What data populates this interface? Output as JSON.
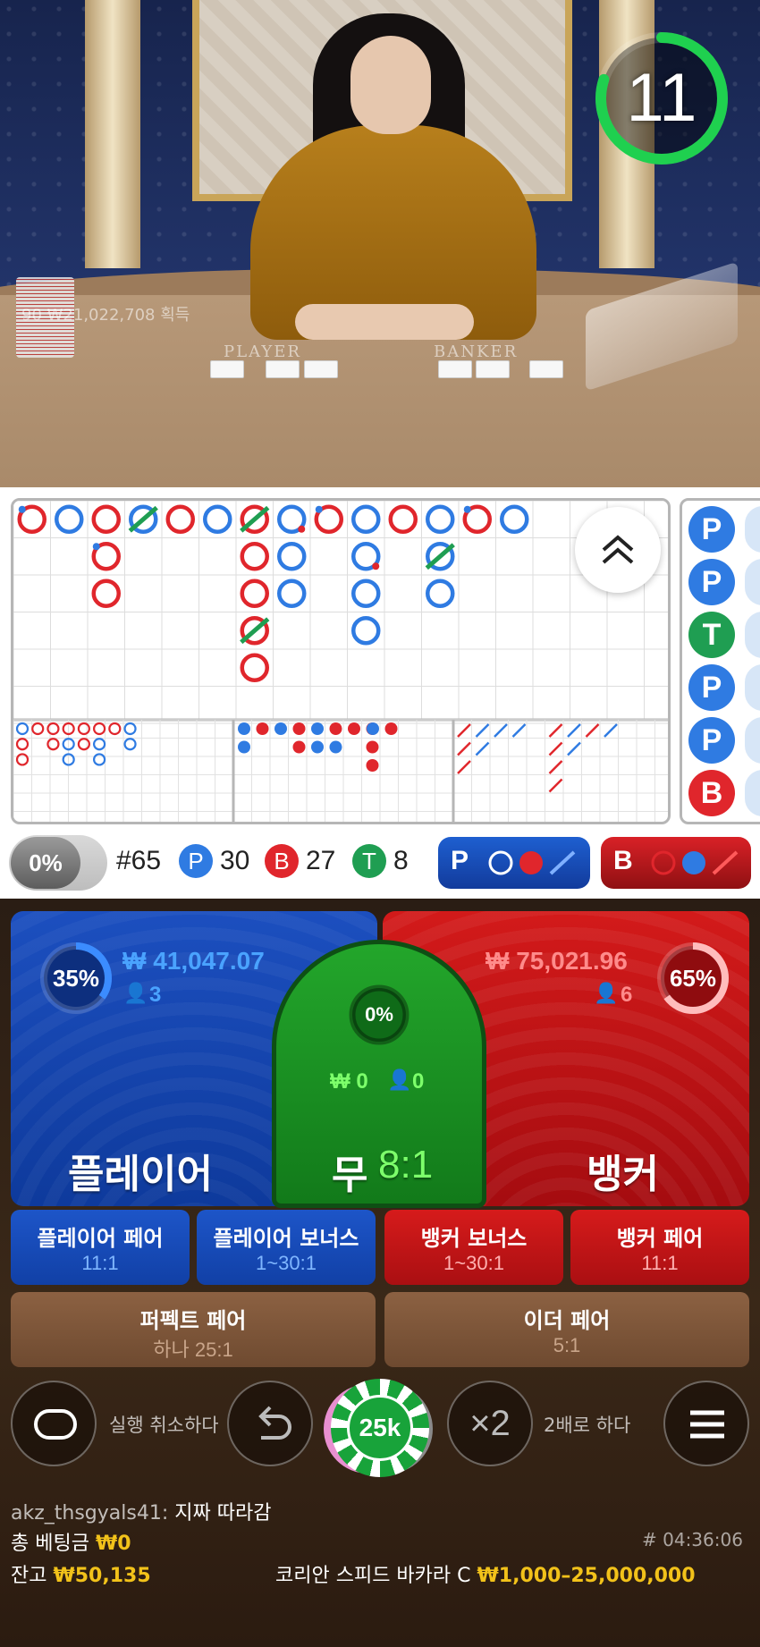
{
  "timer": {
    "seconds": "11",
    "fraction_remaining": 0.8
  },
  "video": {
    "winnings_text": "90 ₩21,022,708 획득",
    "player_label": "PLAYER",
    "banker_label": "BANKER"
  },
  "roadmap": {
    "counts": {
      "game_number": "#65",
      "player_letter": "P",
      "player": "30",
      "banker_letter": "B",
      "banker": "27",
      "tie_letter": "T",
      "tie": "8"
    },
    "percent_toggle": "0%",
    "predict_player_letter": "P",
    "predict_banker_letter": "B",
    "side_road": [
      "P",
      "P",
      "T",
      "P",
      "P",
      "B"
    ],
    "big_road": [
      {
        "col": 0,
        "row": 0,
        "c": "B",
        "tie": false,
        "dot": "blue"
      },
      {
        "col": 1,
        "row": 0,
        "c": "P",
        "tie": false,
        "dot": ""
      },
      {
        "col": 2,
        "row": 0,
        "c": "B",
        "tie": false,
        "dot": ""
      },
      {
        "col": 2,
        "row": 1,
        "c": "B",
        "tie": false,
        "dot": "blue"
      },
      {
        "col": 2,
        "row": 2,
        "c": "B",
        "tie": false,
        "dot": ""
      },
      {
        "col": 3,
        "row": 0,
        "c": "P",
        "tie": true,
        "dot": ""
      },
      {
        "col": 4,
        "row": 0,
        "c": "B",
        "tie": false,
        "dot": ""
      },
      {
        "col": 5,
        "row": 0,
        "c": "P",
        "tie": false,
        "dot": ""
      },
      {
        "col": 6,
        "row": 0,
        "c": "B",
        "tie": true,
        "dot": ""
      },
      {
        "col": 6,
        "row": 1,
        "c": "B",
        "tie": false,
        "dot": ""
      },
      {
        "col": 6,
        "row": 2,
        "c": "B",
        "tie": false,
        "dot": ""
      },
      {
        "col": 6,
        "row": 3,
        "c": "B",
        "tie": true,
        "dot": ""
      },
      {
        "col": 6,
        "row": 4,
        "c": "B",
        "tie": false,
        "dot": ""
      },
      {
        "col": 7,
        "row": 0,
        "c": "P",
        "tie": false,
        "dot": "red"
      },
      {
        "col": 7,
        "row": 1,
        "c": "P",
        "tie": false,
        "dot": ""
      },
      {
        "col": 7,
        "row": 2,
        "c": "P",
        "tie": false,
        "dot": ""
      },
      {
        "col": 8,
        "row": 0,
        "c": "B",
        "tie": false,
        "dot": "blue"
      },
      {
        "col": 9,
        "row": 0,
        "c": "P",
        "tie": false,
        "dot": ""
      },
      {
        "col": 9,
        "row": 1,
        "c": "P",
        "tie": false,
        "dot": "red"
      },
      {
        "col": 9,
        "row": 2,
        "c": "P",
        "tie": false,
        "dot": ""
      },
      {
        "col": 9,
        "row": 3,
        "c": "P",
        "tie": false,
        "dot": ""
      },
      {
        "col": 10,
        "row": 0,
        "c": "B",
        "tie": false,
        "dot": ""
      },
      {
        "col": 11,
        "row": 0,
        "c": "P",
        "tie": false,
        "dot": ""
      },
      {
        "col": 11,
        "row": 1,
        "c": "P",
        "tie": true,
        "dot": ""
      },
      {
        "col": 11,
        "row": 2,
        "c": "P",
        "tie": false,
        "dot": ""
      },
      {
        "col": 12,
        "row": 0,
        "c": "B",
        "tie": false,
        "dot": "blue"
      },
      {
        "col": 13,
        "row": 0,
        "c": "P",
        "tie": false,
        "dot": ""
      }
    ],
    "big_eye": [
      [
        "P",
        "B",
        "B",
        "B",
        "B",
        "B",
        "B",
        "P"
      ],
      [
        "B",
        "",
        "B",
        "P",
        "B",
        "P",
        "",
        "P"
      ],
      [
        "B",
        "",
        "",
        "P",
        "",
        "P",
        "",
        ""
      ]
    ],
    "small_road": [
      [
        "P",
        "B",
        "P",
        "B",
        "P",
        "B",
        "B",
        "B",
        "P",
        "B"
      ],
      [
        "P",
        "",
        "",
        "B",
        "P",
        "P",
        "",
        "B",
        "",
        ""
      ],
      [
        "",
        "",
        "",
        "",
        "",
        "",
        "",
        "B",
        "",
        ""
      ]
    ],
    "cockroach": [
      [
        "B",
        "P",
        "P",
        "P",
        "",
        "B",
        "P",
        "B",
        "P"
      ],
      [
        "B",
        "P",
        "",
        "",
        "",
        "B",
        "P",
        "",
        ""
      ],
      [
        "B",
        "",
        "",
        "",
        "",
        "B",
        "",
        "",
        ""
      ],
      [
        "",
        "",
        "",
        "",
        "",
        "B",
        "",
        "",
        ""
      ]
    ]
  },
  "bets": {
    "player": {
      "label": "플레이어",
      "percent": "35%",
      "percent_value": 0.35,
      "amount": "₩ 41,047.07",
      "count": "3"
    },
    "tie": {
      "label": "무",
      "odds": "8:1",
      "percent": "0%",
      "percent_value": 0,
      "amount": "₩ 0",
      "count": "0"
    },
    "banker": {
      "label": "뱅커",
      "percent": "65%",
      "percent_value": 0.65,
      "amount": "₩ 75,021.96",
      "count": "6"
    },
    "side": [
      {
        "name": "플레이어 페어",
        "odds": "11:1",
        "color": "blue"
      },
      {
        "name": "플레이어 보너스",
        "odds": "1~30:1",
        "color": "blue"
      },
      {
        "name": "뱅커 보너스",
        "odds": "1~30:1",
        "color": "red"
      },
      {
        "name": "뱅커 페어",
        "odds": "11:1",
        "color": "red"
      }
    ],
    "perfect_pair": {
      "name": "퍼펙트 페어",
      "odds": "하나 25:1"
    },
    "either_pair": {
      "name": "이더 페어",
      "odds": "5:1"
    }
  },
  "controls": {
    "undo_label": "실행 취소하다",
    "double_label": "2배로 하다",
    "double_icon": "×2",
    "chip_value": "25k"
  },
  "footer": {
    "chat_user": "akz_thsgyals41:",
    "chat_message": "지짜 따라감",
    "total_bet_label": "총 베팅금",
    "total_bet_value": "₩0",
    "game_id": "# 04:36:06",
    "balance_label": "잔고",
    "balance_value": "₩50,135",
    "table_name": "코리안 스피드 바카라 C",
    "table_limits": "₩1,000–25,000,000"
  },
  "colors": {
    "player": "#2f7be2",
    "banker": "#e0262c",
    "tie": "#1f9e52",
    "gold": "#f2c21a",
    "timer": "#1fd04f"
  }
}
